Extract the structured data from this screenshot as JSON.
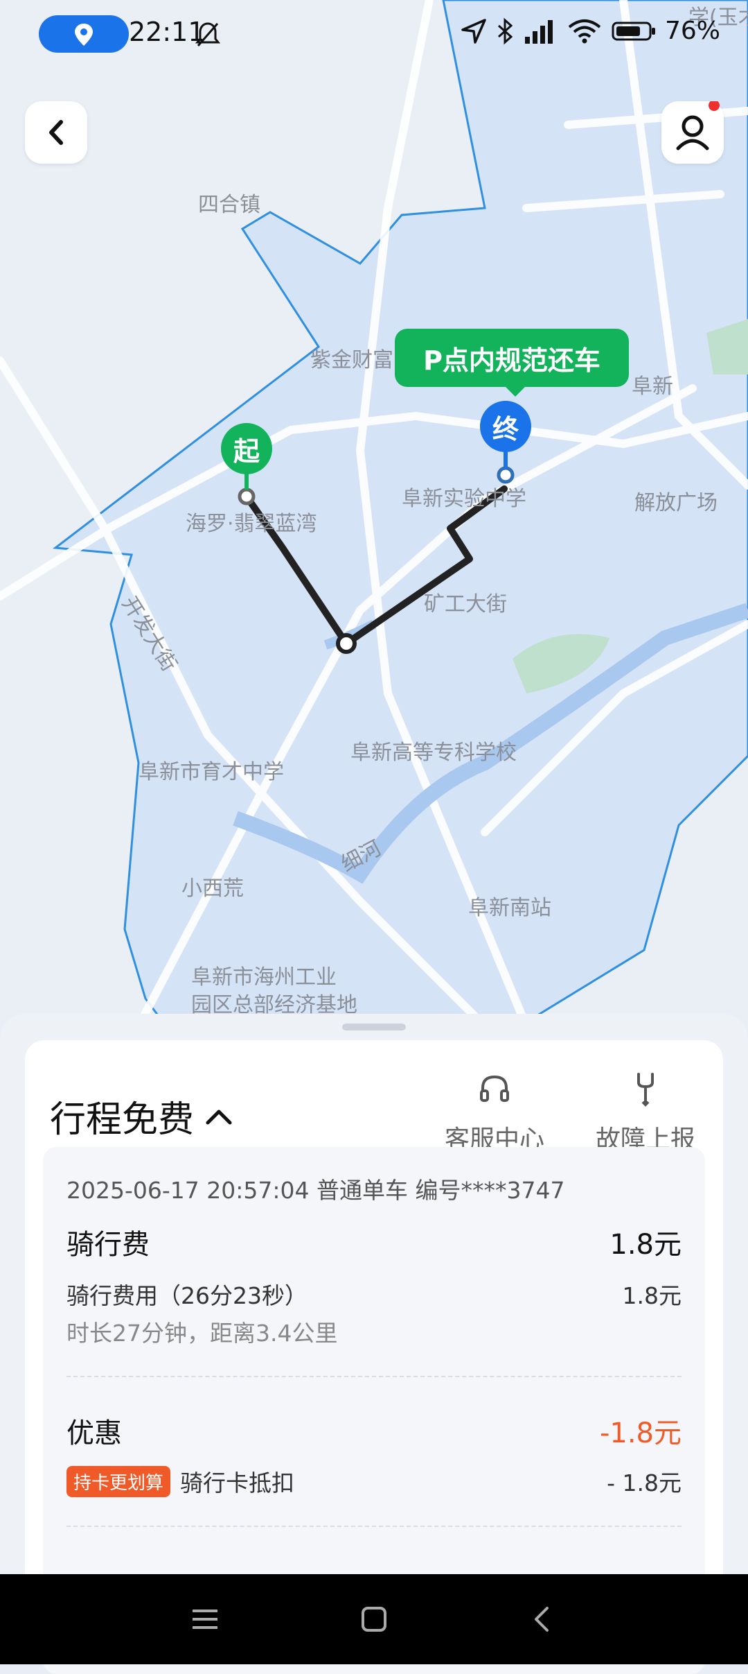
{
  "status_bar": {
    "time": "22:11",
    "battery": "76%"
  },
  "map": {
    "labels": [
      "四合镇",
      "紫金财富",
      "阜新",
      "海罗·翡翠蓝湾",
      "阜新实验中学",
      "解放广场",
      "开发大街",
      "矿工大街",
      "阜新市育才中学",
      "阜新高等专科学校",
      "细河",
      "小西荒",
      "阜新南站",
      "阜新市海州工业",
      "园区总部经济基地",
      "学(玉才"
    ],
    "start_pin": "起",
    "end_pin": "终",
    "bubble": "P点内规范还车"
  },
  "sheet": {
    "title": "行程免费",
    "actions": [
      {
        "label": "客服中心",
        "icon": "headset-icon"
      },
      {
        "label": "故障上报",
        "icon": "wrench-icon"
      }
    ],
    "meta": "2025-06-17 20:57:04 普通单车 编号****3747",
    "ride_fee_label": "骑行费",
    "ride_fee_value": "1.8元",
    "ride_cost_label": "骑行费用（26分23秒）",
    "ride_cost_value": "1.8元",
    "ride_summary": "时长27分钟，距离3.4公里",
    "discount_label": "优惠",
    "discount_value": "-1.8元",
    "card_tag": "持卡更划算",
    "card_label": "骑行卡抵扣",
    "card_value": "- 1.8元"
  },
  "colors": {
    "accent_green": "#13b35b",
    "accent_blue": "#1a73e8",
    "discount_red": "#f05a28"
  }
}
